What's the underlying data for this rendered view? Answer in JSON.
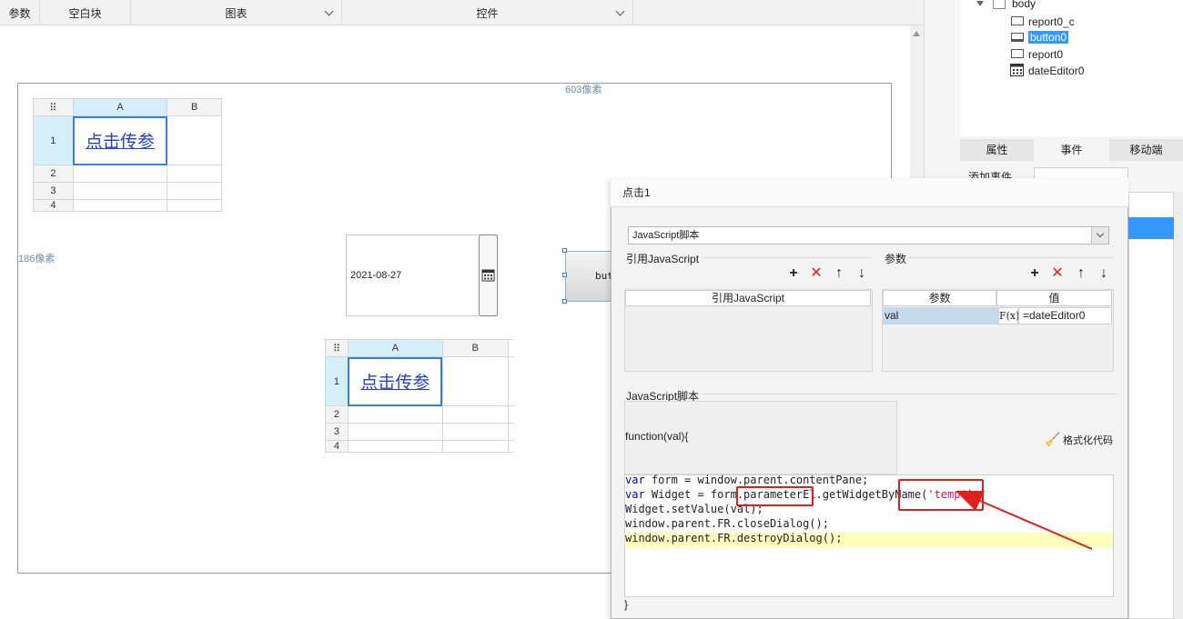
{
  "toolbar": {
    "items": [
      "参数",
      "空白块",
      "图表",
      "控件"
    ]
  },
  "canvas": {
    "width_label": "603像素",
    "height_label": "186像素",
    "table1": {
      "cols": [
        "A",
        "B"
      ],
      "rows": [
        "1",
        "2",
        "3",
        "4"
      ],
      "link_text": "点击传参"
    },
    "date_editor": {
      "value": "2021-08-27"
    },
    "button0_text": "but",
    "table2": {
      "cols": [
        "A",
        "B"
      ],
      "rows": [
        "1",
        "2",
        "3",
        "4"
      ],
      "link_text": "点击传参"
    }
  },
  "tree": {
    "root": "body",
    "items": [
      "report0_c",
      "button0",
      "report0",
      "dateEditor0"
    ],
    "selected": "button0"
  },
  "panel_tabs": [
    "属性",
    "事件",
    "移动端"
  ],
  "add_event_label": "添加事件",
  "dialog": {
    "title": "点击1",
    "script_type": "JavaScript脚本",
    "ref_js_label": "引用JavaScript",
    "ref_js_header": "引用JavaScript",
    "params_label": "参数",
    "params_col1": "参数",
    "params_col2": "值",
    "param_row": {
      "name": "val",
      "fx": "F(x)",
      "value": "=dateEditor0"
    },
    "js_section_label": "JavaScript脚本",
    "function_sig": "function(val){",
    "format_code": "格式化代码",
    "code_lines": [
      "var form = window.parent.contentPane;",
      "var Widget = form.parameterEl.getWidgetByName('temp');",
      "Widget.setValue(val);",
      "window.parent.FR.closeDialog();",
      "window.parent.FR.destroyDialog();"
    ],
    "closing_brace": "}"
  },
  "colors": {
    "selection": "#3a7fd6",
    "highlight_line": "#ffffbe",
    "annotation_red": "#e0201c",
    "tree_selected": "#3399ff"
  }
}
